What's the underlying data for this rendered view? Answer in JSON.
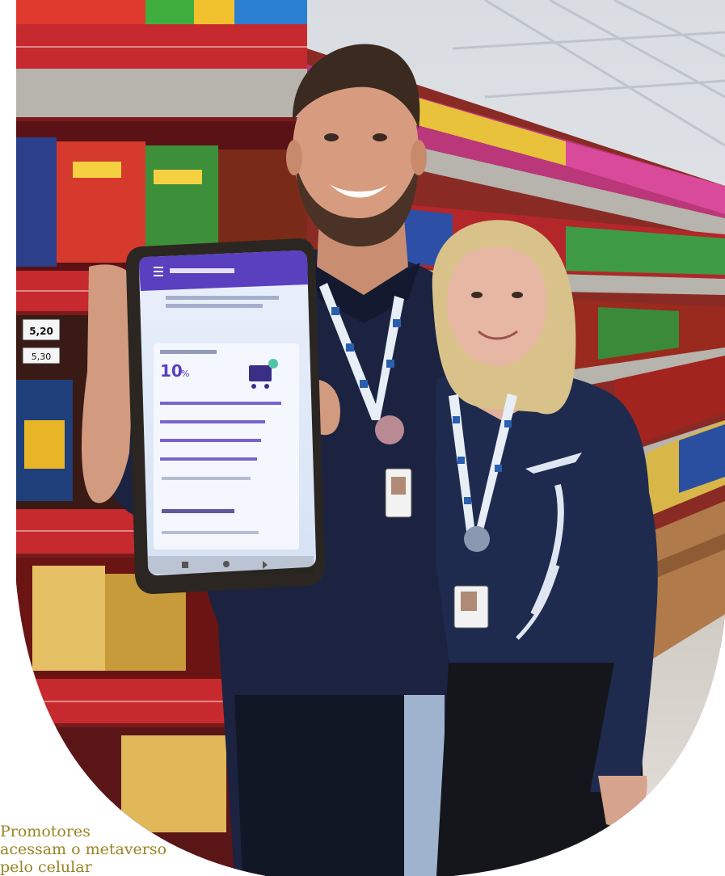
{
  "caption": {
    "line1": "Promotores",
    "line2": "acessam o metaverso",
    "line3": "pelo celular"
  },
  "colors": {
    "caption": "#9a8424",
    "shelf_red": "#b8222a",
    "uniform_navy": "#1c2440",
    "phone_screen": "#dfe8f7",
    "app_accent": "#5a3fbf"
  },
  "phone_screen": {
    "big_value": "10",
    "big_value_unit": "%"
  },
  "price_tags": [
    "5,20",
    "5,30"
  ]
}
